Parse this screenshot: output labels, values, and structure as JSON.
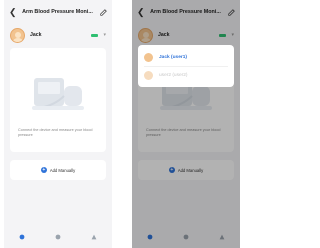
{
  "screens": [
    {
      "header": {
        "title": "Arm Blood Pressure Moni..."
      },
      "user": {
        "name": "Jack"
      },
      "card": {
        "message": "Connect the device and measure your blood pressure"
      },
      "add_button": {
        "label": "Add Manually"
      },
      "tabs": [
        {
          "label": ""
        },
        {
          "label": ""
        },
        {
          "label": ""
        }
      ]
    },
    {
      "header": {
        "title": "Arm Blood Pressure Moni..."
      },
      "user": {
        "name": "Jack"
      },
      "card": {
        "message": "Connect the device and measure your blood pressure"
      },
      "add_button": {
        "label": "Add Manually"
      },
      "dropdown": {
        "items": [
          {
            "label": "Jack (user1)",
            "selected": true
          },
          {
            "label": "user2 (user2)",
            "selected": false
          }
        ]
      },
      "tabs": [
        {
          "label": ""
        },
        {
          "label": ""
        },
        {
          "label": ""
        }
      ]
    }
  ],
  "colors": {
    "accent": "#2f73d9",
    "battery": "#2fbf71",
    "background": "#f4f4f6"
  }
}
